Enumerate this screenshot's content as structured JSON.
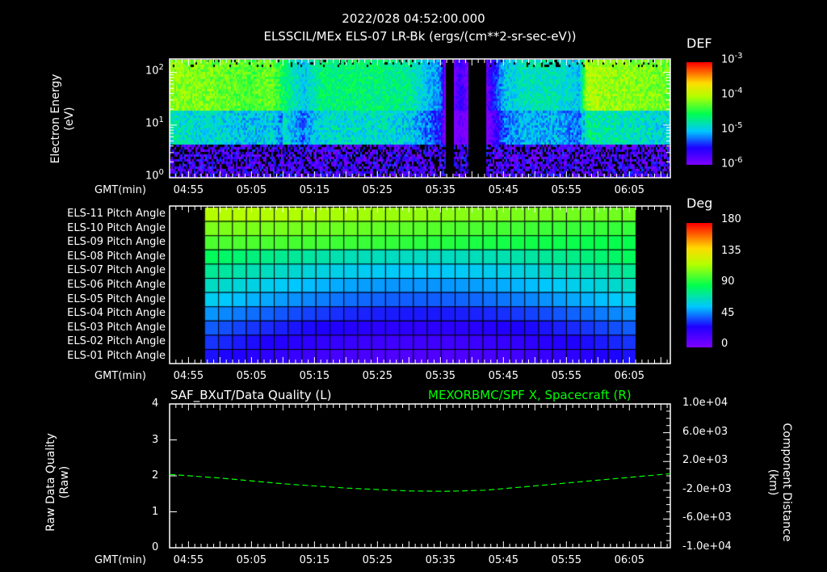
{
  "header": {
    "timestamp": "2022/028 04:52:00.000",
    "title": "ELSSCIL/MEx ELS-07 LR-Bk  (ergs/(cm**2-sr-sec-eV))"
  },
  "time_axis": {
    "label": "GMT(min)",
    "ticks": [
      "04:55",
      "05:05",
      "05:15",
      "05:25",
      "05:35",
      "05:45",
      "05:55",
      "06:05"
    ],
    "start_min": 292,
    "end_min": 371.5
  },
  "chart_data": [
    {
      "type": "heatmap",
      "name": "electron-spectrogram",
      "ylabel": "Electron Energy\n(eV)",
      "ylabel_lines": [
        "Electron Energy",
        "(eV)"
      ],
      "yscale": "log",
      "ylim": [
        1,
        180
      ],
      "yticks": [
        {
          "base": "10",
          "exp": "0"
        },
        {
          "base": "10",
          "exp": "1"
        },
        {
          "base": "10",
          "exp": "2"
        }
      ],
      "colorbar": {
        "title": "DEF",
        "range_log10": [
          -6,
          -3
        ],
        "ticks": [
          {
            "base": "10",
            "exp": "-3"
          },
          {
            "base": "10",
            "exp": "-4"
          },
          {
            "base": "10",
            "exp": "-5"
          },
          {
            "base": "10",
            "exp": "-6"
          }
        ]
      },
      "intensity_profile": {
        "time_min": [
          292,
          300,
          305,
          308,
          311,
          313,
          316,
          325,
          330,
          335,
          336,
          338,
          341,
          343,
          345,
          348,
          353,
          357,
          358,
          364,
          371.5
        ],
        "peak_log10": [
          -4.1,
          -4.2,
          -4.3,
          -4.2,
          -4.7,
          -5.0,
          -4.6,
          -4.6,
          -4.7,
          -5.2,
          -6.5,
          -5.6,
          -6.5,
          -5.6,
          -5.0,
          -4.8,
          -4.8,
          -5.0,
          -4.0,
          -4.1,
          -4.2
        ]
      }
    },
    {
      "type": "heatmap",
      "name": "pitch-angle",
      "rows": [
        "ELS-11 Pitch Angle",
        "ELS-10 Pitch Angle",
        "ELS-09 Pitch Angle",
        "ELS-08 Pitch Angle",
        "ELS-07 Pitch Angle",
        "ELS-06 Pitch Angle",
        "ELS-05 Pitch Angle",
        "ELS-04 Pitch Angle",
        "ELS-03 Pitch Angle",
        "ELS-02 Pitch Angle",
        "ELS-01 Pitch Angle"
      ],
      "row_values_deg": [
        115,
        105,
        97,
        88,
        78,
        70,
        62,
        52,
        44,
        38,
        33
      ],
      "time_range": [
        297.5,
        366
      ],
      "columns": 31,
      "colorbar": {
        "title": "Deg",
        "ticks": [
          "180",
          "135",
          "90",
          "45",
          "0"
        ],
        "range": [
          0,
          180
        ]
      }
    },
    {
      "type": "line",
      "name": "data-quality-and-position",
      "left_title": "SAF_BXuT/Data Quality (L)",
      "right_title": "MEXORBMC/SPF X, Spacecraft (R)",
      "ylabel_left_lines": [
        "Raw Data Quality",
        "(Raw)"
      ],
      "ylabel_right_lines": [
        "Component Distance",
        "(km)"
      ],
      "left_ylim": [
        0,
        4
      ],
      "left_ticks": [
        "4",
        "3",
        "2",
        "1",
        "0"
      ],
      "right_ylim": [
        -10000,
        10000
      ],
      "right_ticks": [
        "1.0e+04",
        "6.0e+03",
        "2.0e+03",
        "-2.0e+03",
        "-6.0e+03",
        "-1.0e+04"
      ],
      "series": [
        {
          "name": "Data Quality",
          "axis": "left",
          "color": "#ffffff",
          "x": [
            297,
            366
          ],
          "y": [
            0,
            0
          ]
        },
        {
          "name": "SPF X",
          "axis": "right",
          "color": "#00ff00",
          "x": [
            292,
            300,
            310,
            320,
            330,
            336,
            342,
            350,
            360,
            371.5
          ],
          "y": [
            200,
            -300,
            -1100,
            -1700,
            -2100,
            -2150,
            -2000,
            -1400,
            -600,
            300
          ]
        }
      ]
    }
  ]
}
